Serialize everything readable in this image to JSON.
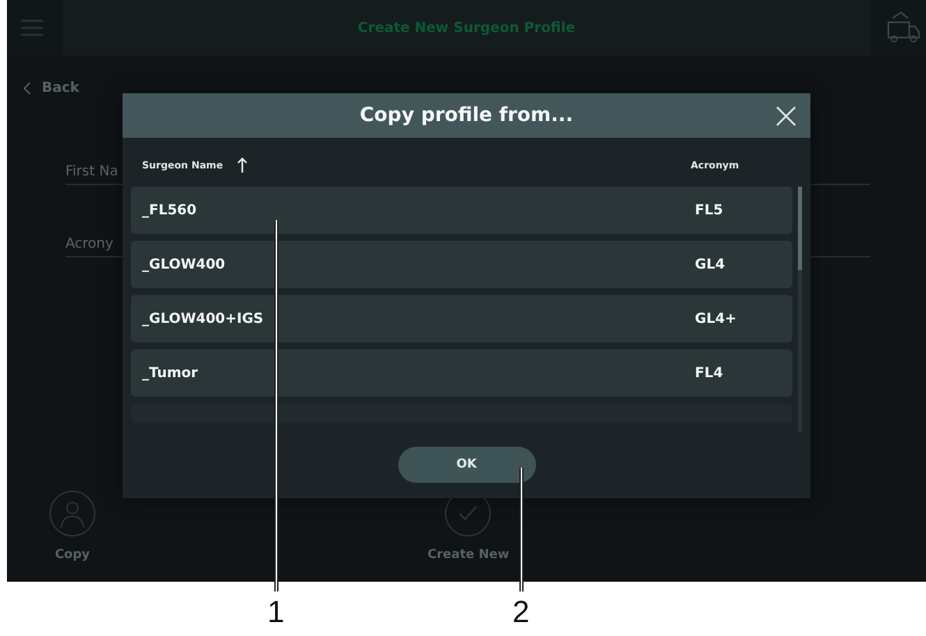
{
  "top_bar": {
    "title": "Create New Surgeon Profile"
  },
  "back": {
    "label": "Back"
  },
  "form_fields": [
    {
      "label": "First Na"
    },
    {
      "label": "Acrony"
    }
  ],
  "actions": [
    {
      "label": "Copy",
      "kind": "copy"
    },
    {
      "label": "Create New",
      "kind": "create"
    }
  ],
  "dialog": {
    "title": "Copy profile from...",
    "columns": [
      "Surgeon Name",
      "Acronym"
    ],
    "rows": [
      {
        "name": "_FL560",
        "acronym": "FL5"
      },
      {
        "name": "_GLOW400",
        "acronym": "GL4"
      },
      {
        "name": "_GLOW400+IGS",
        "acronym": "GL4+"
      },
      {
        "name": "_Tumor",
        "acronym": "FL4"
      }
    ],
    "ok": "OK"
  },
  "callouts": [
    "1",
    "2"
  ]
}
